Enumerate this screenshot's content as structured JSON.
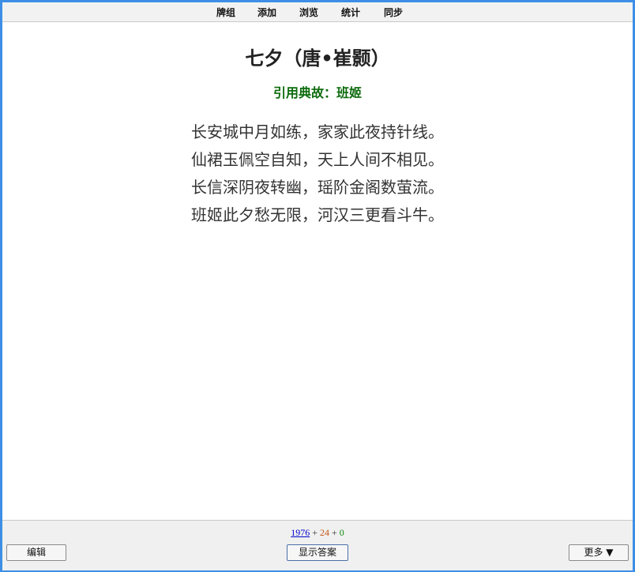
{
  "toolbar": {
    "items": [
      "牌组",
      "添加",
      "浏览",
      "统计",
      "同步"
    ]
  },
  "card": {
    "title": "七夕（唐•崔颢）",
    "allusion": "引用典故：班姬",
    "lines": [
      "长安城中月如练，家家此夜持针线。",
      "仙裙玉佩空自知，天上人间不相见。",
      "长信深阴夜转幽，瑶阶金阁数萤流。",
      "班姬此夕愁无限，河汉三更看斗牛。"
    ]
  },
  "counts": {
    "new": "1976",
    "sep1": " + ",
    "learning": "24",
    "sep2": " + ",
    "review": "0"
  },
  "bottom": {
    "edit_label": "编辑",
    "show_answer_label": "显示答案",
    "more_label": "更多 ▼"
  },
  "colors": {
    "frame": "#3d8fe6",
    "allusion": "#0d6b0d",
    "new": "#0000cc",
    "learning": "#c35617",
    "review": "#0a8a0a"
  }
}
